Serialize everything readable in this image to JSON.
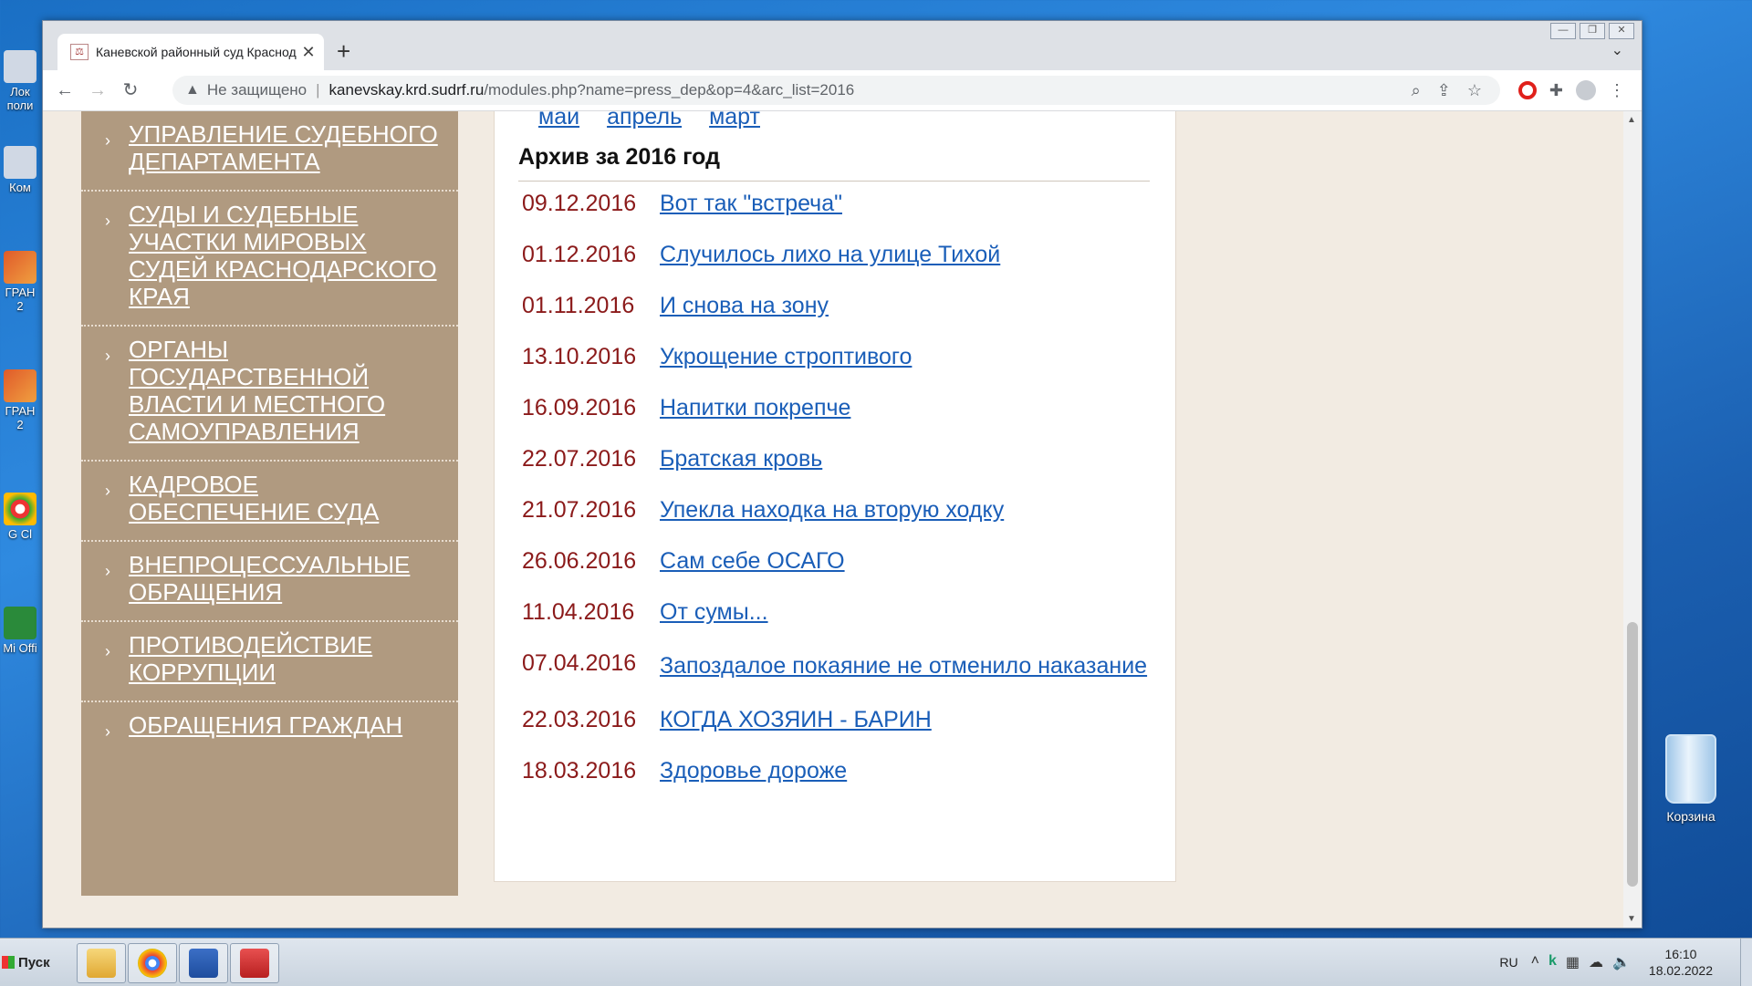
{
  "desktop": {
    "left_icons": [
      {
        "label": "Лок поли",
        "icon": "network-drive-icon"
      },
      {
        "label": "Ком",
        "icon": "computer-icon"
      },
      {
        "label": "ГРАН 2",
        "icon": "app-shortcut-icon"
      },
      {
        "label": "ГРАН 2",
        "icon": "app-shortcut-icon"
      },
      {
        "label": "G Cl",
        "icon": "chrome-shortcut-icon"
      },
      {
        "label": "Mi Offi",
        "icon": "office-shortcut-icon"
      }
    ],
    "recycle_bin_label": "Корзина"
  },
  "browser": {
    "tab_title": "Каневской районный суд Краснод",
    "tab_close": "✕",
    "new_tab": "+",
    "tab_menu": "⌄",
    "security_label": "Не защищено",
    "url_host": "kanevskay.krd.sudrf.ru",
    "url_path": "/modules.php?name=press_dep&op=4&arc_list=2016"
  },
  "sidebar": {
    "items": [
      {
        "label": "УПРАВЛЕНИЕ СУДЕБНОГО ДЕПАРТАМЕНТА"
      },
      {
        "label": "СУДЫ И СУДЕБНЫЕ УЧАСТКИ МИРОВЫХ СУДЕЙ КРАСНОДАРСКОГО КРАЯ"
      },
      {
        "label": "ОРГАНЫ ГОСУДАРСТВЕННОЙ ВЛАСТИ И МЕСТНОГО САМОУПРАВЛЕНИЯ"
      },
      {
        "label": "КАДРОВОЕ ОБЕСПЕЧЕНИЕ СУДА"
      },
      {
        "label": "ВНЕПРОЦЕССУАЛЬНЫЕ ОБРАЩЕНИЯ"
      },
      {
        "label": "ПРОТИВОДЕЙСТВИЕ КОРРУПЦИИ"
      },
      {
        "label": "ОБРАЩЕНИЯ ГРАЖДАН"
      }
    ]
  },
  "content": {
    "months": [
      "май",
      "апрель",
      "март"
    ],
    "archive_title": "Архив за 2016 год",
    "news": [
      {
        "date": "09.12.2016",
        "title": "Вот так \"встреча\""
      },
      {
        "date": "01.12.2016",
        "title": "Случилось лихо на улице Тихой"
      },
      {
        "date": "01.11.2016",
        "title": "И снова на зону"
      },
      {
        "date": "13.10.2016",
        "title": "Укрощение строптивого"
      },
      {
        "date": "16.09.2016",
        "title": "Напитки покрепче"
      },
      {
        "date": "22.07.2016",
        "title": "Братская кровь"
      },
      {
        "date": "21.07.2016",
        "title": "Упекла находка на вторую ходку"
      },
      {
        "date": "26.06.2016",
        "title": "Сам себе ОСАГО"
      },
      {
        "date": "11.04.2016",
        "title": "От сумы..."
      },
      {
        "date": "07.04.2016",
        "title": "Запоздалое покаяние не отменило наказание"
      },
      {
        "date": "22.03.2016",
        "title": "КОГДА ХОЗЯИН - БАРИН"
      },
      {
        "date": "18.03.2016",
        "title": "Здоровье дороже"
      }
    ]
  },
  "taskbar": {
    "start_label": "Пуск",
    "apps": [
      {
        "name": "explorer",
        "icon": "folder-icon"
      },
      {
        "name": "chrome",
        "icon": "chrome-icon"
      },
      {
        "name": "word",
        "icon": "word-icon"
      },
      {
        "name": "app",
        "icon": "red-app-icon"
      }
    ],
    "language": "RU",
    "time": "16:10",
    "date": "18.02.2022"
  },
  "colors": {
    "sidebar_bg": "#b09a80",
    "page_bg": "#f2ebe2",
    "date_color": "#8b1a1a",
    "link_color": "#1a5eb8"
  }
}
